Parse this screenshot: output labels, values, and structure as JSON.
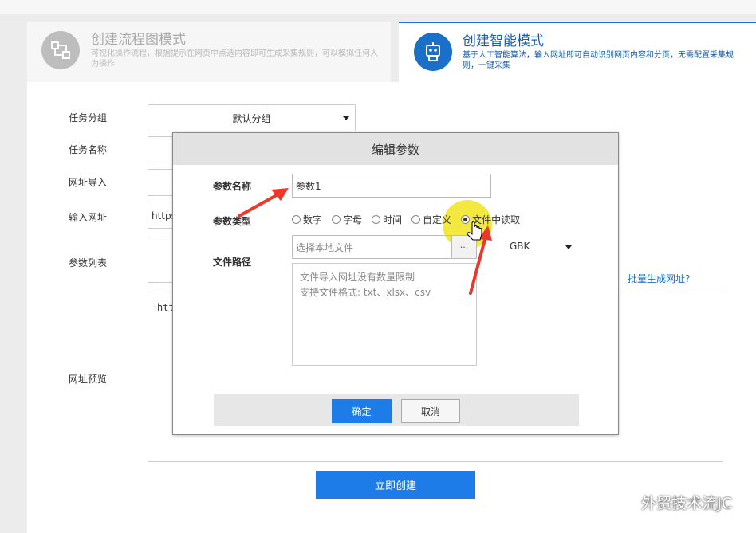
{
  "modes": {
    "flow": {
      "title": "创建流程图模式",
      "description": "可视化操作流程，根据提示在网页中点选内容即可生成采集规则，可以模拟任何人为操作",
      "icon": "flowchart-icon"
    },
    "smart": {
      "title": "创建智能模式",
      "description": "基于人工智能算法，输入网址即可自动识别网页内容和分页，无需配置采集规则，一键采集",
      "icon": "robot-icon"
    }
  },
  "form": {
    "labels": {
      "group": "任务分组",
      "name": "任务名称",
      "url_import": "网址导入",
      "url_input": "输入网址",
      "param_list": "参数列表",
      "url_preview": "网址预览"
    },
    "group_value": "默认分组",
    "url_value": "https",
    "batch_link": "批量生成网址?",
    "preview_text": "htt",
    "create_button": "立即创建"
  },
  "modal": {
    "title": "编辑参数",
    "param_name_label": "参数名称",
    "param_name_value": "参数1",
    "param_type_label": "参数类型",
    "types": [
      {
        "label": "数字",
        "checked": false
      },
      {
        "label": "字母",
        "checked": false
      },
      {
        "label": "时间",
        "checked": false
      },
      {
        "label": "自定义",
        "checked": false
      },
      {
        "label": "文件中读取",
        "checked": true
      }
    ],
    "file_path_label": "文件路径",
    "file_placeholder": "选择本地文件",
    "browse_label": "···",
    "encoding": "GBK",
    "hint_line1": "文件导入网址没有数量限制",
    "hint_line2": "支持文件格式: txt、xlsx、csv",
    "ok_button": "确定",
    "cancel_button": "取消"
  },
  "watermark": "外贸技术流JC",
  "colors": {
    "accent": "#1e7ce8",
    "brand_dark": "#1a5ea8",
    "arrow": "#e8392c",
    "highlight": "#f0e41e"
  }
}
